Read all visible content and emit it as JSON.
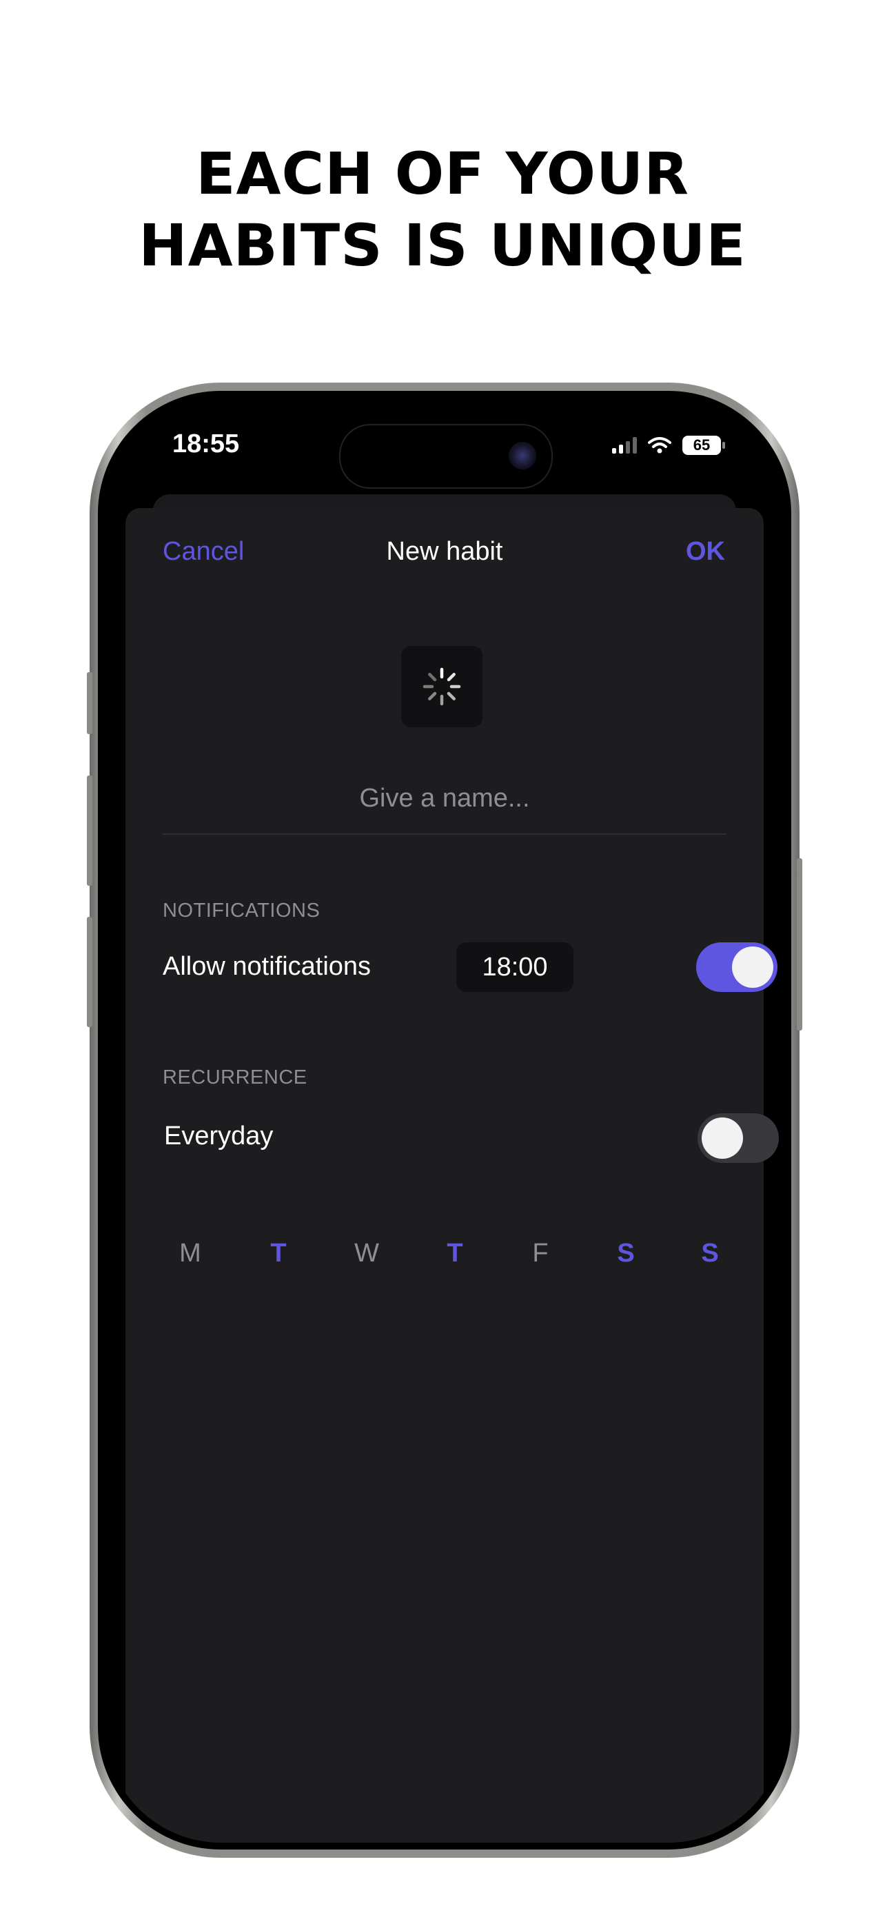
{
  "headline": {
    "line1": "EACH OF YOUR",
    "line2": "HABITS IS UNIQUE"
  },
  "status_bar": {
    "time": "18:55",
    "battery": "65",
    "icons": [
      "signal-icon",
      "wifi-icon",
      "battery-icon"
    ]
  },
  "nav": {
    "cancel": "Cancel",
    "title": "New habit",
    "ok": "OK"
  },
  "habit_icon": "loading-spinner-icon",
  "name_input": {
    "value": "",
    "placeholder": "Give a name..."
  },
  "notifications": {
    "section_label": "NOTIFICATIONS",
    "label": "Allow notifications",
    "time": "18:00",
    "enabled": true
  },
  "recurrence": {
    "section_label": "RECURRENCE",
    "label": "Everyday",
    "everyday_enabled": false,
    "days": [
      {
        "label": "M",
        "selected": false
      },
      {
        "label": "T",
        "selected": true
      },
      {
        "label": "W",
        "selected": false
      },
      {
        "label": "T",
        "selected": true
      },
      {
        "label": "F",
        "selected": false
      },
      {
        "label": "S",
        "selected": true
      },
      {
        "label": "S",
        "selected": true
      }
    ]
  },
  "colors": {
    "accent": "#5e56e0",
    "sheet_background": "#1d1d20",
    "secondary_text": "#8e8e93"
  }
}
